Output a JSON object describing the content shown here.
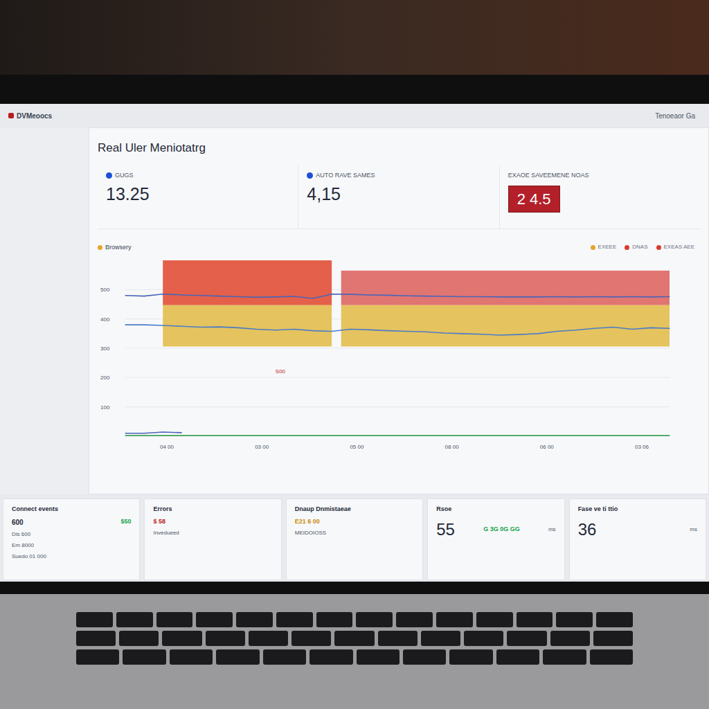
{
  "window": {
    "title": "DVMeoocs"
  },
  "topbar": {
    "right": "Tenoeaor Ga"
  },
  "panel_title": "Real Uler Meniotatrg",
  "metrics": [
    {
      "label": "GUGS",
      "value": "13.25",
      "kind": "dot"
    },
    {
      "label": "AUTO RAVE SAMES",
      "value": "4,15",
      "kind": "dot"
    },
    {
      "label": "EXAOE SAVEEMENE NOAS",
      "value": "2 4.5",
      "kind": "alert"
    }
  ],
  "chart": {
    "title": "Browsery",
    "y_ticks": [
      "500",
      "400",
      "300",
      "200",
      "100"
    ],
    "x_ticks": [
      "04 00",
      "03 00",
      "05 00",
      "08 00",
      "06 00",
      "03 06"
    ],
    "legend": [
      {
        "label": "EXEEE",
        "color": "#e4a52b"
      },
      {
        "label": "DNAS",
        "color": "#d93b2b"
      },
      {
        "label": "EXEAS AEE",
        "color": "#d93b2b"
      }
    ],
    "annotation": "S00",
    "bands": [
      {
        "color": "#e4604a",
        "from": 447,
        "to": 600,
        "start": 2,
        "end": 11
      },
      {
        "color": "#e5c35e",
        "from": 306,
        "to": 447,
        "start": 2,
        "end": 11
      },
      {
        "color": "#e07572",
        "from": 447,
        "to": 565,
        "start": 11.5,
        "end": 29
      },
      {
        "color": "#e5c35e",
        "from": 306,
        "to": 447,
        "start": 11.5,
        "end": 29
      }
    ],
    "series": [
      {
        "color": "#4a64b8",
        "values": [
          480,
          478,
          485,
          482,
          480,
          478,
          476,
          474,
          475,
          477,
          470,
          485,
          484,
          482,
          481,
          479,
          478,
          477,
          476,
          476,
          475,
          475,
          475,
          476,
          475,
          476,
          475,
          476,
          475,
          476
        ]
      },
      {
        "color": "#4a7cc8",
        "values": [
          380,
          380,
          378,
          375,
          372,
          373,
          370,
          365,
          362,
          365,
          360,
          358,
          365,
          363,
          360,
          358,
          356,
          352,
          350,
          348,
          345,
          347,
          350,
          358,
          362,
          368,
          372,
          365,
          370,
          368
        ]
      },
      {
        "color": "#3aa055",
        "values": [
          2,
          2,
          2,
          2,
          2,
          2,
          2,
          2,
          2,
          2,
          2,
          2,
          2,
          2,
          2,
          2,
          2,
          2,
          2,
          2,
          2,
          2,
          2,
          2,
          2,
          2,
          2,
          2,
          2,
          2
        ]
      },
      {
        "color": "#4a64b8",
        "values": [
          10,
          10,
          14,
          12
        ]
      }
    ]
  },
  "cards": [
    {
      "title": "Connect events",
      "value": "600",
      "unit": "",
      "badge": "$50",
      "badge_color": "#16a34a",
      "lines": [
        "Dis 600",
        "Em 8000",
        "Suedo 01 000"
      ]
    },
    {
      "title": "Errors",
      "value": "",
      "unit": "",
      "badge": "$ 58",
      "badge_color": "#b91c1c",
      "lines": [
        "Invedueed"
      ]
    },
    {
      "title": "Dnaup Dnmistaeae",
      "value": "",
      "unit": "",
      "badge": "E21 6 00",
      "badge_color": "#ca8a04",
      "lines": [
        "MEIDOIOSS"
      ]
    },
    {
      "title": "Rsoe",
      "value": "55",
      "unit": "ms",
      "badge": "G 3G 0G GG",
      "badge_color": "#16a34a",
      "lines": []
    },
    {
      "title": "Fase ve ti ttio",
      "value": "36",
      "unit": "ms",
      "badge": "",
      "badge_color": "#374151",
      "lines": []
    }
  ]
}
